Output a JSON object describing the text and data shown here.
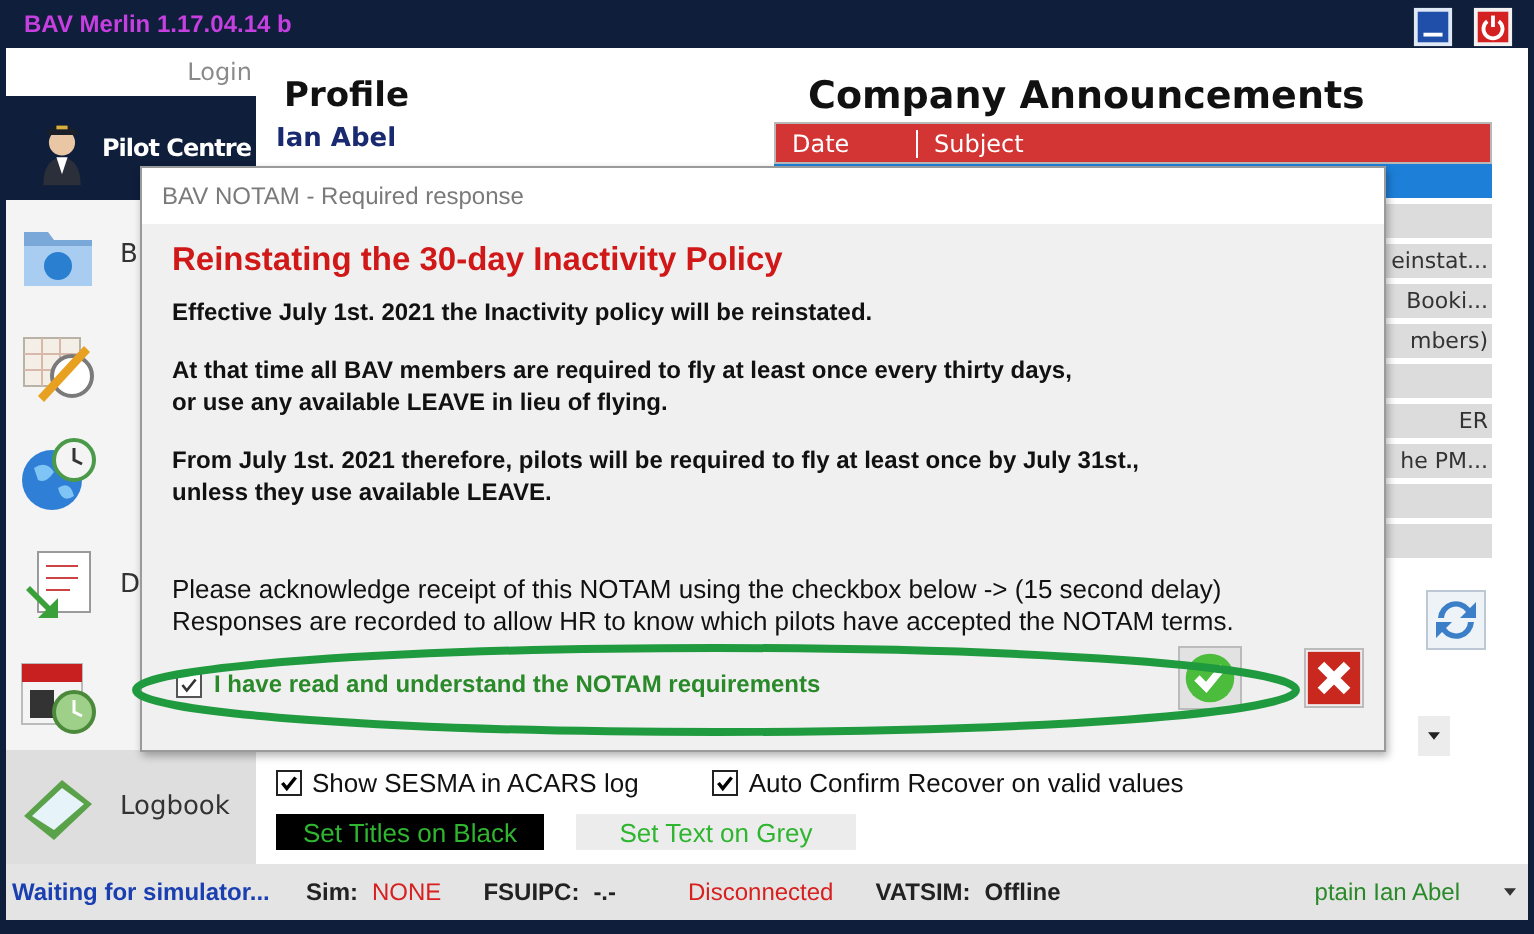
{
  "window": {
    "title": "BAV Merlin 1.17.04.14 b"
  },
  "sidebar": {
    "login": "Login",
    "items": [
      {
        "kind": "pilot",
        "label": "Pilot Centre",
        "selected": true
      },
      {
        "kind": "folder",
        "label": "B",
        "selected": false
      },
      {
        "kind": "planner",
        "selected": false
      },
      {
        "kind": "globe",
        "selected": false
      },
      {
        "kind": "document",
        "label": "D",
        "selected": false
      },
      {
        "kind": "calendar",
        "selected": false
      },
      {
        "kind": "logbook",
        "label": "Logbook",
        "selected": false
      }
    ]
  },
  "profile": {
    "title": "Profile",
    "name": "Ian Abel"
  },
  "announcements": {
    "title": "Company Announcements",
    "columns": [
      "Date",
      "Subject"
    ],
    "rows": [
      {
        "selected": true
      },
      {
        "selected": false
      },
      {
        "subject": "einstat...",
        "selected": false
      },
      {
        "subject": "Booki...",
        "selected": false
      },
      {
        "subject": "mbers)",
        "selected": false
      },
      {
        "selected": false
      },
      {
        "subject": "ER",
        "selected": false
      },
      {
        "subject": "he PM...",
        "selected": false
      },
      {
        "selected": false
      },
      {
        "selected": false
      }
    ]
  },
  "options": {
    "checkboxes": [
      {
        "label": "Show SESMA in ACARS log",
        "checked": true
      },
      {
        "label": "Auto Confirm Recover on valid values",
        "checked": true
      }
    ],
    "buttons": [
      {
        "label": "Set Titles on Black",
        "kind": "black"
      },
      {
        "label": "Set Text on Grey",
        "kind": "grey"
      }
    ]
  },
  "status_bar": {
    "items": [
      {
        "kind": "message",
        "text": "Waiting for simulator..."
      },
      {
        "kind": "field",
        "label": "Sim:",
        "value": "NONE",
        "alert": true
      },
      {
        "kind": "field",
        "label": "FSUIPC:",
        "value": "-.-",
        "alert": false
      },
      {
        "kind": "status",
        "text": "Disconnected",
        "alert": true
      },
      {
        "kind": "field",
        "label": "VATSIM:",
        "value": "Offline",
        "alert": false
      },
      {
        "kind": "user",
        "text": "ptain Ian Abel"
      }
    ]
  },
  "dialog": {
    "title": "BAV NOTAM - Required response",
    "heading": "Reinstating the 30-day Inactivity Policy",
    "paragraphs": [
      "Effective July 1st. 2021 the Inactivity policy will be reinstated.",
      "At that time all BAV members are required to fly at least once every thirty days,\nor use any available LEAVE in lieu of flying.",
      "From July 1st. 2021 therefore, pilots will be required to fly at least once by July 31st.,\nunless they use available LEAVE."
    ],
    "instructions": "Please acknowledge receipt of this NOTAM using the checkbox below  ->  (15 second delay)\nResponses are recorded to allow HR to know which pilots have accepted the NOTAM terms.",
    "acknowledge": {
      "label": "I have read and understand the NOTAM requirements",
      "checked": true
    }
  }
}
